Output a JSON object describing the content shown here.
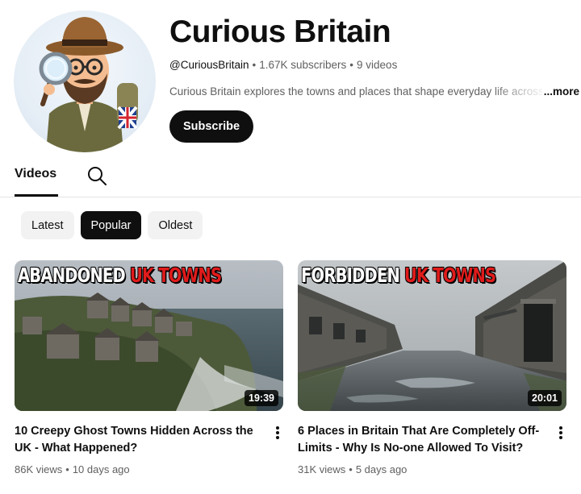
{
  "channel": {
    "name": "Curious Britain",
    "handle": "@CuriousBritain",
    "subscribers": "1.67K subscribers",
    "video_count": "9 videos",
    "separator": "•",
    "description": "Curious Britain explores the towns and places that shape everyday life across the",
    "more_label": "...more",
    "subscribe_label": "Subscribe"
  },
  "tabs": {
    "videos_label": "Videos",
    "search_icon": "search-icon"
  },
  "chips": [
    {
      "label": "Latest",
      "active": false
    },
    {
      "label": "Popular",
      "active": true
    },
    {
      "label": "Oldest",
      "active": false
    }
  ],
  "videos": [
    {
      "thumb_title_white": "ABANDONED",
      "thumb_title_red": "UK TOWNS",
      "duration": "19:39",
      "title": "10 Creepy Ghost Towns Hidden Across the UK - What Happened?",
      "views": "86K views",
      "age": "10 days ago"
    },
    {
      "thumb_title_white": "FORBIDDEN",
      "thumb_title_red": "UK TOWNS",
      "duration": "20:01",
      "title": "6 Places in Britain That Are Completely Off-Limits - Why Is No-one Allowed To Visit?",
      "views": "31K views",
      "age": "5 days ago"
    }
  ],
  "colors": {
    "text_primary": "#0f0f0f",
    "text_secondary": "#606060",
    "chip_bg": "#f2f2f2",
    "thumb_title_red": "#e01b1b"
  }
}
